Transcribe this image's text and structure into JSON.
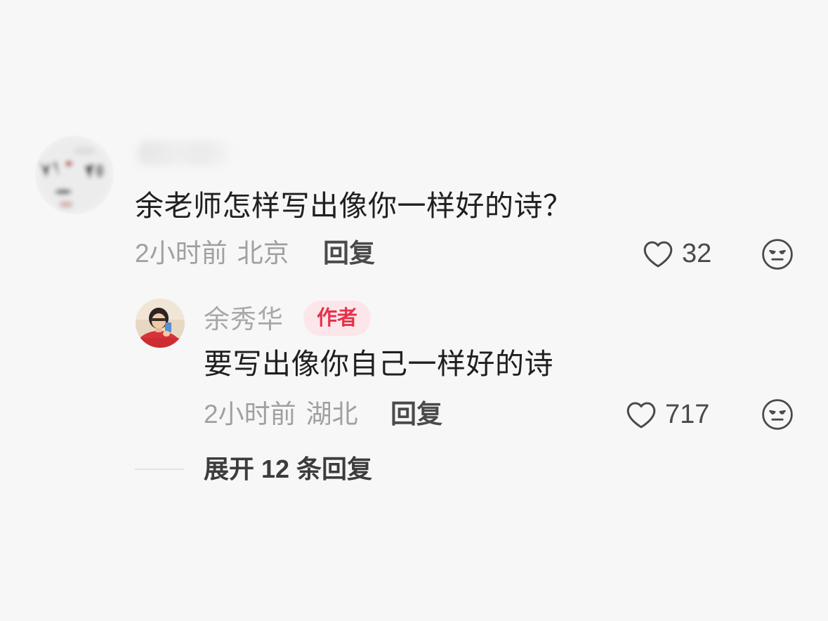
{
  "comment": {
    "text": "余老师怎样写出像你一样好的诗？",
    "time": "2小时前",
    "location": "北京",
    "reply_label": "回复",
    "likes": "32"
  },
  "reply": {
    "author": "余秀华",
    "badge": "作者",
    "text": "要写出像你自己一样好的诗",
    "time": "2小时前",
    "location": "湖北",
    "reply_label": "回复",
    "likes": "717"
  },
  "expand": {
    "label": "展开 12 条回复"
  },
  "icons": {
    "like": "heart-icon",
    "dislike": "meh-face-icon"
  },
  "colors": {
    "background": "#f7f7f7",
    "badge_bg": "#fde6ea",
    "badge_text": "#e5324b",
    "meta_text": "#a0a0a0"
  }
}
